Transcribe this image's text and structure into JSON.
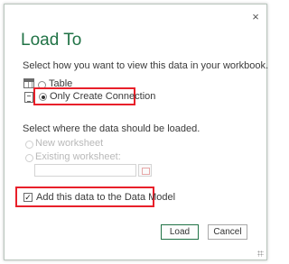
{
  "dialog": {
    "title": "Load To",
    "close_glyph": "×",
    "prompt_view": "Select how you want to view this data in your workbook.",
    "view_options": {
      "table_label": "Table",
      "table_icon": "table-icon",
      "connection_label": "Only Create Connection",
      "connection_icon": "connection-icon",
      "selected": "Only Create Connection"
    },
    "prompt_location": "Select where the data should be loaded.",
    "location_options": {
      "new_worksheet_label": "New worksheet",
      "existing_worksheet_label": "Existing worksheet:",
      "existing_worksheet_value": "",
      "enabled": false
    },
    "data_model": {
      "label": "Add this data to the Data Model",
      "checked": true,
      "check_glyph": "✓"
    },
    "buttons": {
      "load_label": "Load",
      "cancel_label": "Cancel"
    },
    "colors": {
      "title": "#217346",
      "highlight": "#e8202a"
    }
  }
}
